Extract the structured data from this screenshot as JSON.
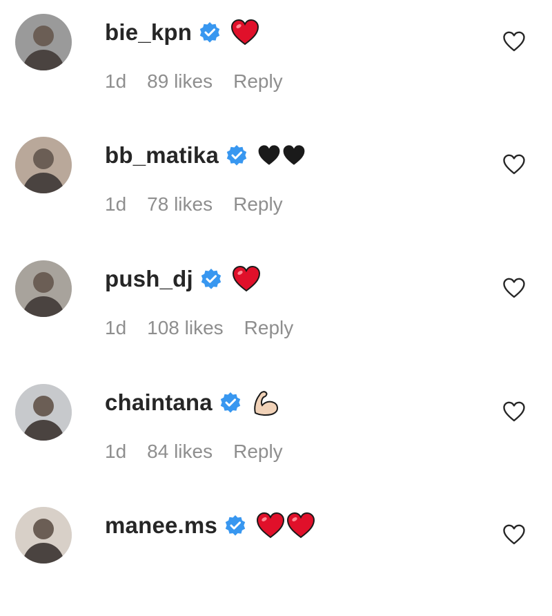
{
  "comments": [
    {
      "username": "bie_kpn",
      "emojis": [
        "red-heart"
      ],
      "time": "1d",
      "likes": "89 likes",
      "reply": "Reply",
      "avatar_tone": "#9a9a9a"
    },
    {
      "username": "bb_matika",
      "emojis": [
        "black-heart",
        "black-heart"
      ],
      "time": "1d",
      "likes": "78 likes",
      "reply": "Reply",
      "avatar_tone": "#b9a89a"
    },
    {
      "username": "push_dj",
      "emojis": [
        "red-heart"
      ],
      "time": "1d",
      "likes": "108 likes",
      "reply": "Reply",
      "avatar_tone": "#a8a39c"
    },
    {
      "username": "chaintana",
      "emojis": [
        "flexed-biceps"
      ],
      "time": "1d",
      "likes": "84 likes",
      "reply": "Reply",
      "avatar_tone": "#c7c9cc"
    },
    {
      "username": "manee.ms",
      "emojis": [
        "red-heart",
        "red-heart"
      ],
      "time": "",
      "likes": "",
      "reply": "",
      "avatar_tone": "#d8d0c8"
    }
  ],
  "colors": {
    "username": "#262626",
    "meta": "#8e8e8e",
    "verified": "#3897f0",
    "heart_red": "#e0102a",
    "heart_black": "#1a1a1a",
    "outline": "#262626"
  },
  "icons": {
    "verified": "verified-badge-icon",
    "like": "heart-outline-icon"
  }
}
